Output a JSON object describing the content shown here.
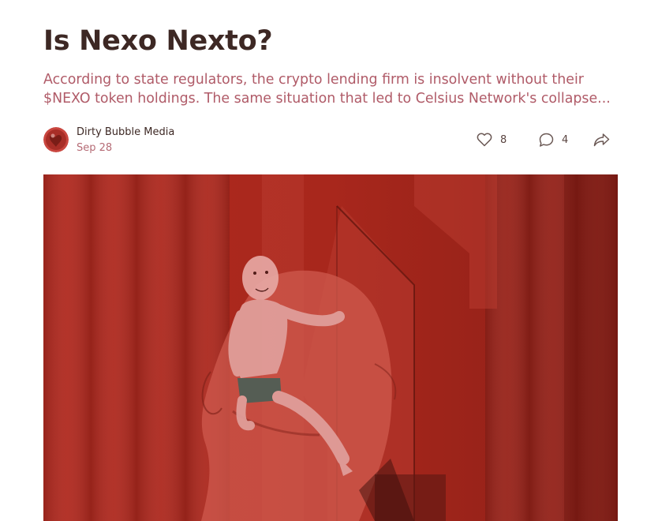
{
  "post": {
    "title": "Is Nexo Nexto?",
    "subtitle_lines": [
      "According to state regulators, the crypto lending firm is insolvent without their",
      "$NEXO token holdings. The same situation that led to Celsius Network's collapse..."
    ]
  },
  "author": {
    "name": "Dirty Bubble Media",
    "date": "Sep 28",
    "avatar_icon": "avatar-red-bubble"
  },
  "actions": {
    "like": {
      "icon": "heart-icon",
      "count": "8"
    },
    "comment": {
      "icon": "comment-bubble-icon",
      "count": "4"
    },
    "share": {
      "icon": "share-arrow-icon"
    }
  },
  "colors": {
    "title": "#3d2824",
    "subtitle": "#b05b68",
    "date": "#b56b75",
    "hero_tint": "#a9271d"
  }
}
